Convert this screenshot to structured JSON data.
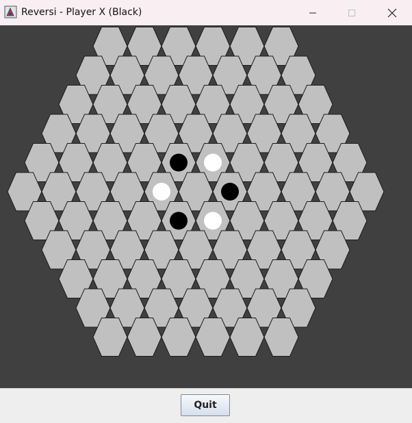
{
  "window": {
    "title": "Reversi - Player X (Black)",
    "app_icon": "reversi-app-icon",
    "controls": [
      "minimize-icon",
      "maximize-icon",
      "close-icon"
    ]
  },
  "board": {
    "shape": "hexagon",
    "side_length": 6,
    "cell_color": "#c0c0c0",
    "background_color": "#404040",
    "pieces": [
      {
        "color": "black",
        "q": 0,
        "r": -1
      },
      {
        "color": "white",
        "q": 1,
        "r": -1
      },
      {
        "color": "white",
        "q": -1,
        "r": 0
      },
      {
        "color": "black",
        "q": 1,
        "r": 0
      },
      {
        "color": "black",
        "q": -1,
        "r": 1
      },
      {
        "color": "white",
        "q": 0,
        "r": 1
      }
    ]
  },
  "footer": {
    "quit_label": "Quit"
  }
}
